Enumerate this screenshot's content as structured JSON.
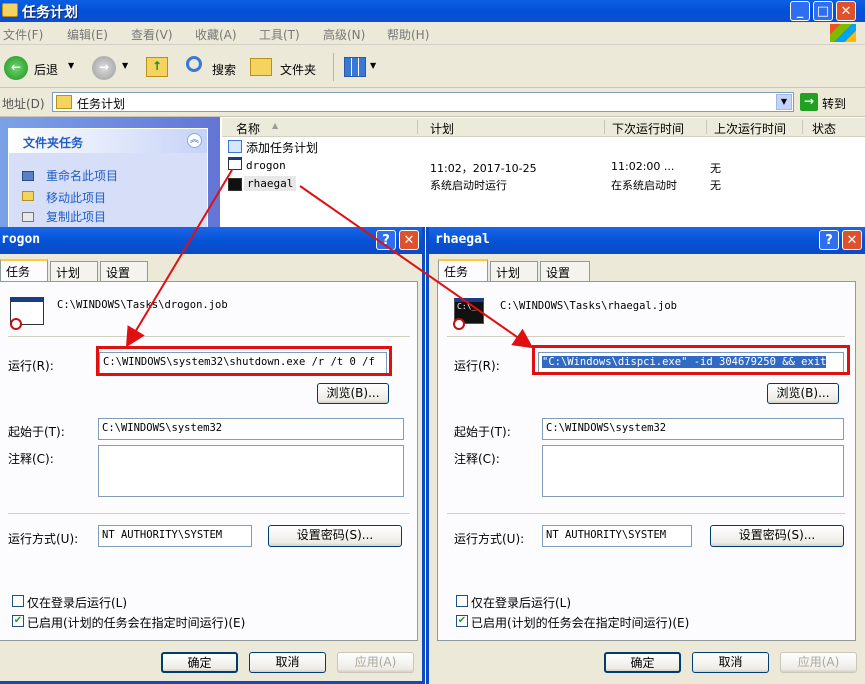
{
  "window": {
    "title": "任务计划"
  },
  "menu": [
    "文件(F)",
    "编辑(E)",
    "查看(V)",
    "收藏(A)",
    "工具(T)",
    "高级(N)",
    "帮助(H)"
  ],
  "toolbar": {
    "back": "后退",
    "search": "搜索",
    "folders": "文件夹"
  },
  "address": {
    "label": "地址(D)",
    "value": "任务计划",
    "go": "转到"
  },
  "folder_tasks": {
    "title": "文件夹任务",
    "items": [
      "重命名此项目",
      "移动此项目",
      "复制此项目"
    ]
  },
  "list": {
    "headers": [
      "名称",
      "计划",
      "下次运行时间",
      "上次运行时间",
      "状态"
    ],
    "rows": [
      {
        "name": "添加任务计划",
        "schedule": "",
        "next": "",
        "last": ""
      },
      {
        "name": "drogon",
        "schedule": "11:02，2017-10-25",
        "next": "11:02:00 ...",
        "last": "无"
      },
      {
        "name": "rhaegal",
        "schedule": "系统启动时运行",
        "next": "在系统启动时",
        "last": "无"
      }
    ]
  },
  "dialog_left": {
    "title": "rogon",
    "tabs": [
      "任务",
      "计划",
      "设置"
    ],
    "path": "C:\\WINDOWS\\Tasks\\drogon.job",
    "run_label": "运行(R):",
    "run_value": "C:\\WINDOWS\\system32\\shutdown.exe /r /t 0 /f",
    "browse": "浏览(B)...",
    "start_label": "起始于(T):",
    "start_value": "C:\\WINDOWS\\system32",
    "comment_label": "注释(C):",
    "runas_label": "运行方式(U):",
    "runas_value": "NT AUTHORITY\\SYSTEM",
    "setpwd": "设置密码(S)...",
    "chk1": "仅在登录后运行(L)",
    "chk2": "已启用(计划的任务会在指定时间运行)(E)",
    "ok": "确定",
    "cancel": "取消",
    "apply": "应用(A)"
  },
  "dialog_right": {
    "title": "rhaegal",
    "tabs": [
      "任务",
      "计划",
      "设置"
    ],
    "path": "C:\\WINDOWS\\Tasks\\rhaegal.job",
    "run_label": "运行(R):",
    "run_value": "\"C:\\Windows\\dispci.exe\" -id 304679250 && exit",
    "browse": "浏览(B)...",
    "start_label": "起始于(T):",
    "start_value": "C:\\WINDOWS\\system32",
    "comment_label": "注释(C):",
    "runas_label": "运行方式(U):",
    "runas_value": "NT AUTHORITY\\SYSTEM",
    "setpwd": "设置密码(S)...",
    "chk1": "仅在登录后运行(L)",
    "chk2": "已启用(计划的任务会在指定时间运行)(E)",
    "ok": "确定",
    "cancel": "取消",
    "apply": "应用(A)"
  },
  "colors": {
    "xp_blue": "#0452d6",
    "highlight_red": "#e01010",
    "selection": "#316ac5"
  }
}
